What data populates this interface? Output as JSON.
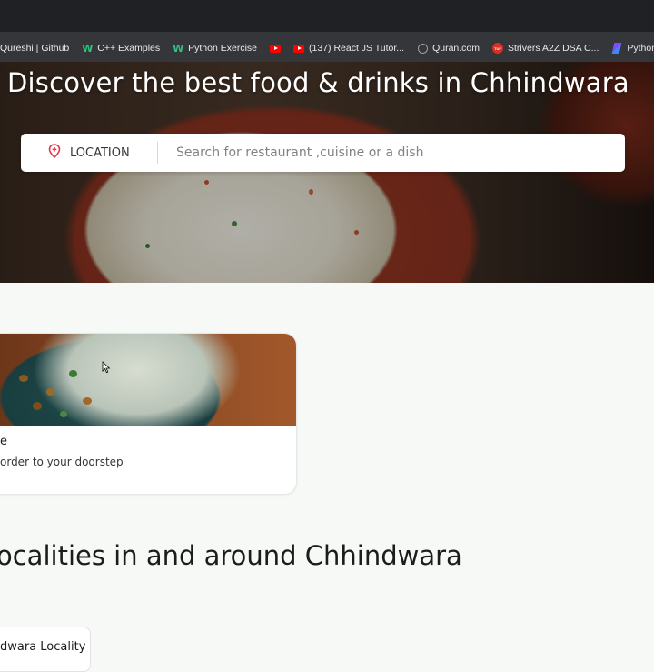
{
  "bookmarks": [
    {
      "label": "Qureshi | Github",
      "icon": "none"
    },
    {
      "label": "C++ Examples",
      "icon": "w3-icon"
    },
    {
      "label": "Python Exercise",
      "icon": "w3-icon"
    },
    {
      "label": "",
      "icon": "youtube-icon"
    },
    {
      "label": "(137) React JS Tutor...",
      "icon": "youtube-icon"
    },
    {
      "label": "Quran.com",
      "icon": "quran-icon"
    },
    {
      "label": "Strivers A2Z DSA C...",
      "icon": "tuf-icon"
    },
    {
      "label": "Python Exan",
      "icon": "python-icon"
    }
  ],
  "hero": {
    "title": "Discover the best food & drinks in Chhindwara"
  },
  "search": {
    "location_label": "LOCATION",
    "placeholder": "Search for restaurant ,cuisine or a dish"
  },
  "card": {
    "title": "e",
    "subtitle": "order to your doorstep"
  },
  "localities": {
    "heading": "ocalities in and around Chhindwara",
    "first_item": "dwara Locality"
  },
  "colors": {
    "accent": "#e23744",
    "browser_bg": "#202124",
    "bookmarks_bg": "#35363a",
    "page_bg": "#f6f9f6"
  }
}
